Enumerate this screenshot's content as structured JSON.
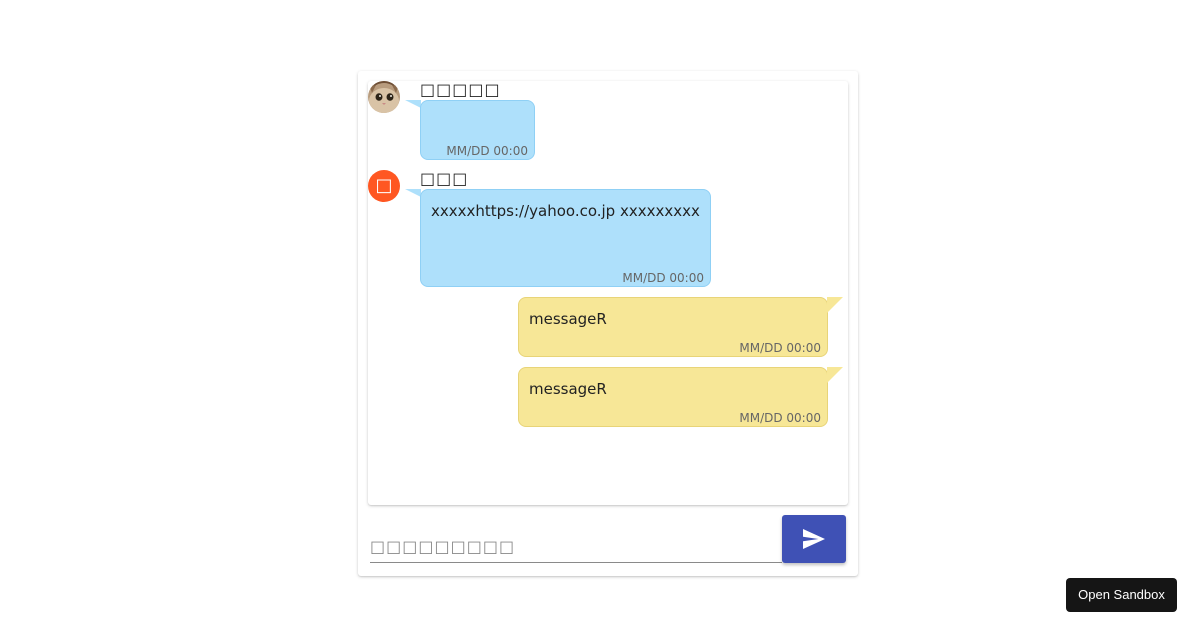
{
  "messages": [
    {
      "side": "left",
      "author": "□□□□□",
      "avatar": "cat-photo-avatar",
      "text": "",
      "time": "MM/DD 00:00"
    },
    {
      "side": "left",
      "author": "□□□",
      "avatar_letter": "□",
      "text": "xxxxxhttps://yahoo.co.jp xxxxxxxxx",
      "time": "MM/DD 00:00"
    },
    {
      "side": "right",
      "text": "messageR",
      "time": "MM/DD 00:00"
    },
    {
      "side": "right",
      "text": "messageR",
      "time": "MM/DD 00:00"
    }
  ],
  "composer": {
    "placeholder": "□□□□□□□□□",
    "value": "",
    "send_icon": "send-icon"
  },
  "sandbox_button": {
    "label": "Open Sandbox"
  },
  "colors": {
    "left_bubble": "#aee0fb",
    "right_bubble": "#f7e797",
    "letter_avatar": "#ff5722",
    "send_button": "#3f51b5",
    "sandbox_button": "#151515"
  }
}
